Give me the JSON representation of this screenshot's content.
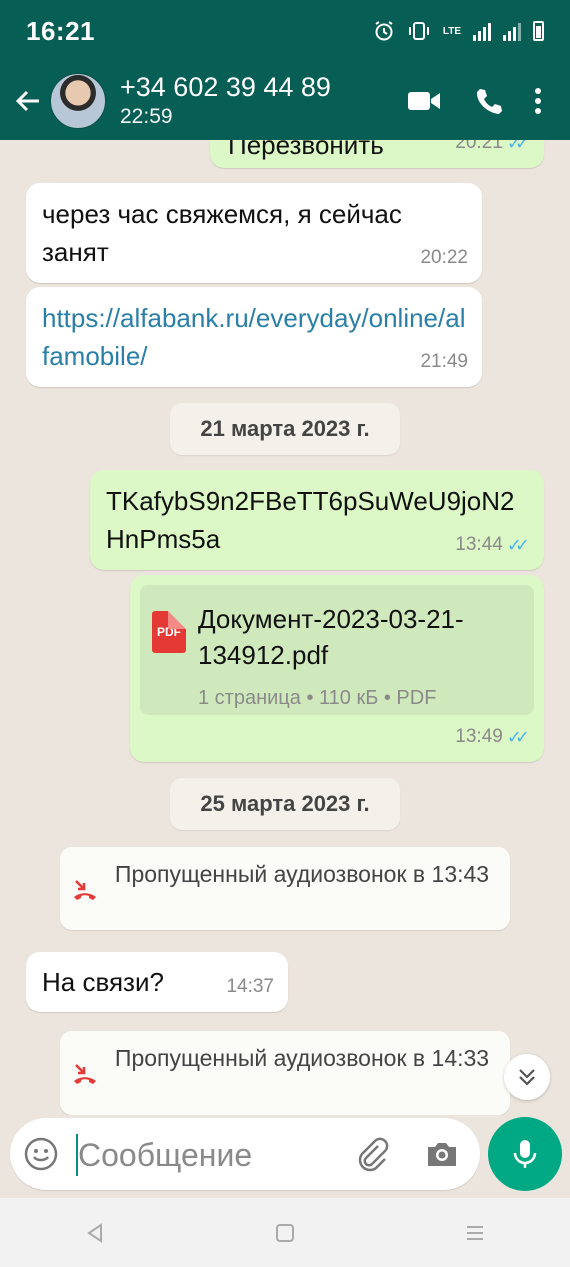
{
  "status_bar": {
    "time": "16:21",
    "network": "LTE"
  },
  "header": {
    "contact_name": "+34 602 39 44 89",
    "last_seen": "22:59"
  },
  "messages": [
    {
      "direction": "out",
      "text": "Перезвонить",
      "time": "20:21",
      "status": "read"
    },
    {
      "direction": "in",
      "text": "через час свяжемся, я сейчас занят",
      "time": "20:22"
    },
    {
      "direction": "in",
      "link": "https://alfabank.ru/everyday/online/alfamobile/",
      "time": "21:49"
    },
    {
      "type": "date",
      "text": "21 марта 2023 г."
    },
    {
      "direction": "out",
      "text": "TKafybS9n2FBeTT6pSuWeU9joN2HnPms5a",
      "time": "13:44",
      "status": "read"
    },
    {
      "direction": "out",
      "type": "document",
      "file_name": "Документ-2023-03-21-134912.pdf",
      "icon": "PDF",
      "file_meta": "1 страница • 110 кБ • PDF",
      "time": "13:49",
      "status": "read"
    },
    {
      "type": "date",
      "text": "25 марта 2023 г."
    },
    {
      "type": "missed_call",
      "text": "Пропущенный аудиозвонок в 13:43"
    },
    {
      "direction": "in",
      "text": "На связи?",
      "time": "14:37"
    },
    {
      "type": "missed_call",
      "text": "Пропущенный аудиозвонок в 14:33"
    }
  ],
  "composer": {
    "placeholder": "Сообщение"
  },
  "colors": {
    "header": "#075e54",
    "outgoing": "#dcf8c6",
    "incoming": "#ffffff",
    "accent": "#00a884",
    "ticks": "#4fb6ec",
    "missed": "#e53935"
  }
}
